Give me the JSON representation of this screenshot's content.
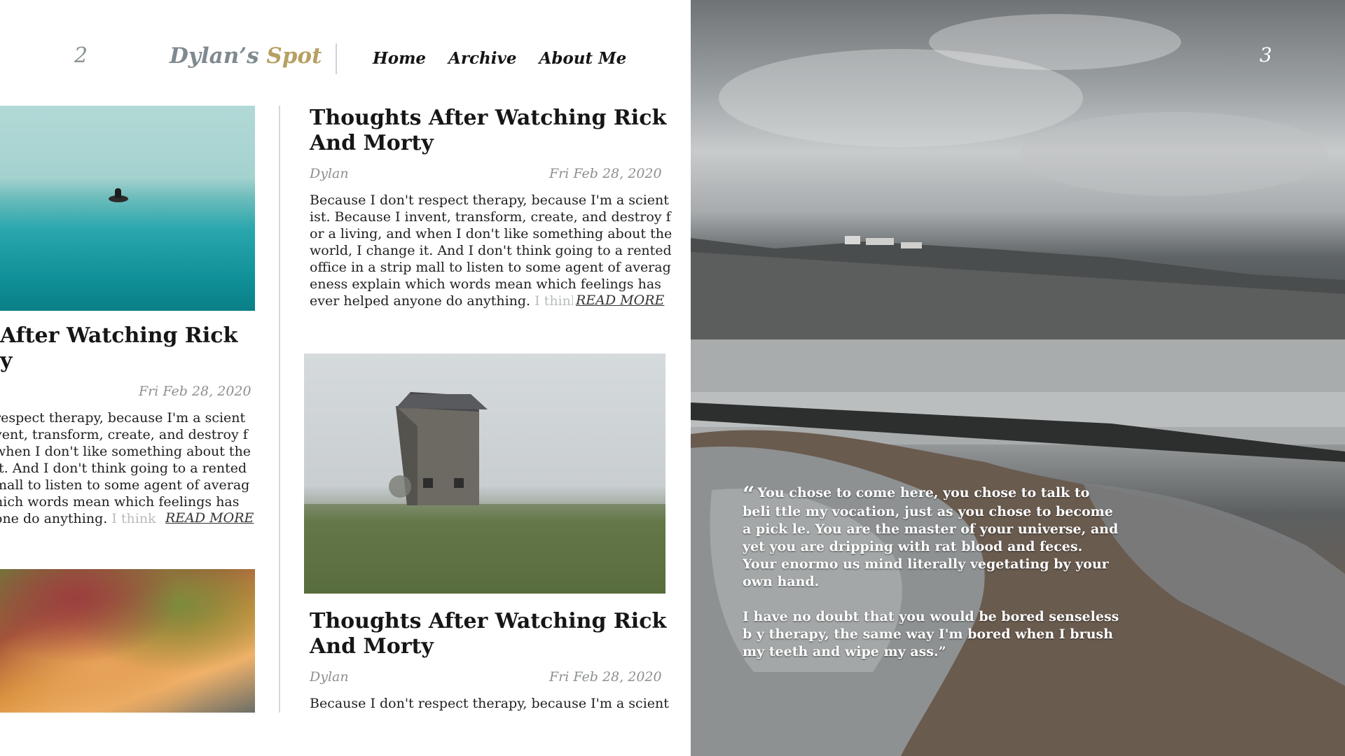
{
  "left_page": {
    "page_number": "2",
    "brand": {
      "part1": "Dylan’s ",
      "part2": "Spot"
    },
    "nav": [
      {
        "label": "Home"
      },
      {
        "label": "Archive"
      },
      {
        "label": "About Me"
      }
    ]
  },
  "posts": {
    "left_column": {
      "title_line1": "After Watching Rick",
      "title_line2": "y",
      "date": "Fri Feb 28, 2020",
      "excerpt_lines": [
        " respect therapy, because I'm a scient",
        "vent, transform, create, and destroy f",
        "when I don't like something about the",
        " it. And I don't think going to a rented",
        " mall to listen to some agent of averag",
        "hich words mean which feelings has",
        "one do anything. "
      ],
      "excerpt_fade": "I think",
      "read_more": "READ MORE"
    },
    "right_top": {
      "title_line1": "Thoughts After Watching Rick",
      "title_line2": "And Morty",
      "author": "Dylan",
      "date": "Fri Feb 28, 2020",
      "excerpt_lines": [
        "Because I don't respect therapy, because I'm a scient",
        "ist. Because I invent, transform, create, and destroy f",
        "or a living, and when I don't like something about the",
        "world, I change it. And I don't think going to a rented",
        "office in a strip mall to listen to some agent of averag",
        "eness explain which words mean which feelings has",
        "ever helped anyone do anything. "
      ],
      "excerpt_fade": "I think",
      "read_more": "READ MORE"
    },
    "right_bottom": {
      "title_line1": "Thoughts After Watching Rick",
      "title_line2": "And Morty",
      "author": "Dylan",
      "date": "Fri Feb 28, 2020",
      "excerpt_first_line": "Because I don't respect therapy, because I'm a scient"
    }
  },
  "right_page": {
    "page_number": "3",
    "quote_mark": "“",
    "quote_paragraph1": "You chose to come here, you chose to talk to beli ttle my vocation, just as you chose to become a pick le. You are the master of your universe, and yet you are dripping with rat blood and feces. Your enormo us mind literally vegetating by your own hand.",
    "quote_paragraph2": "I have no doubt that you would be bored senseless b y therapy, the same way I'm bored when I brush my teeth and wipe my ass.”"
  },
  "colors": {
    "brand_primary": "#7f8a90",
    "brand_accent": "#b6a063",
    "divider": "#d5d8da"
  }
}
